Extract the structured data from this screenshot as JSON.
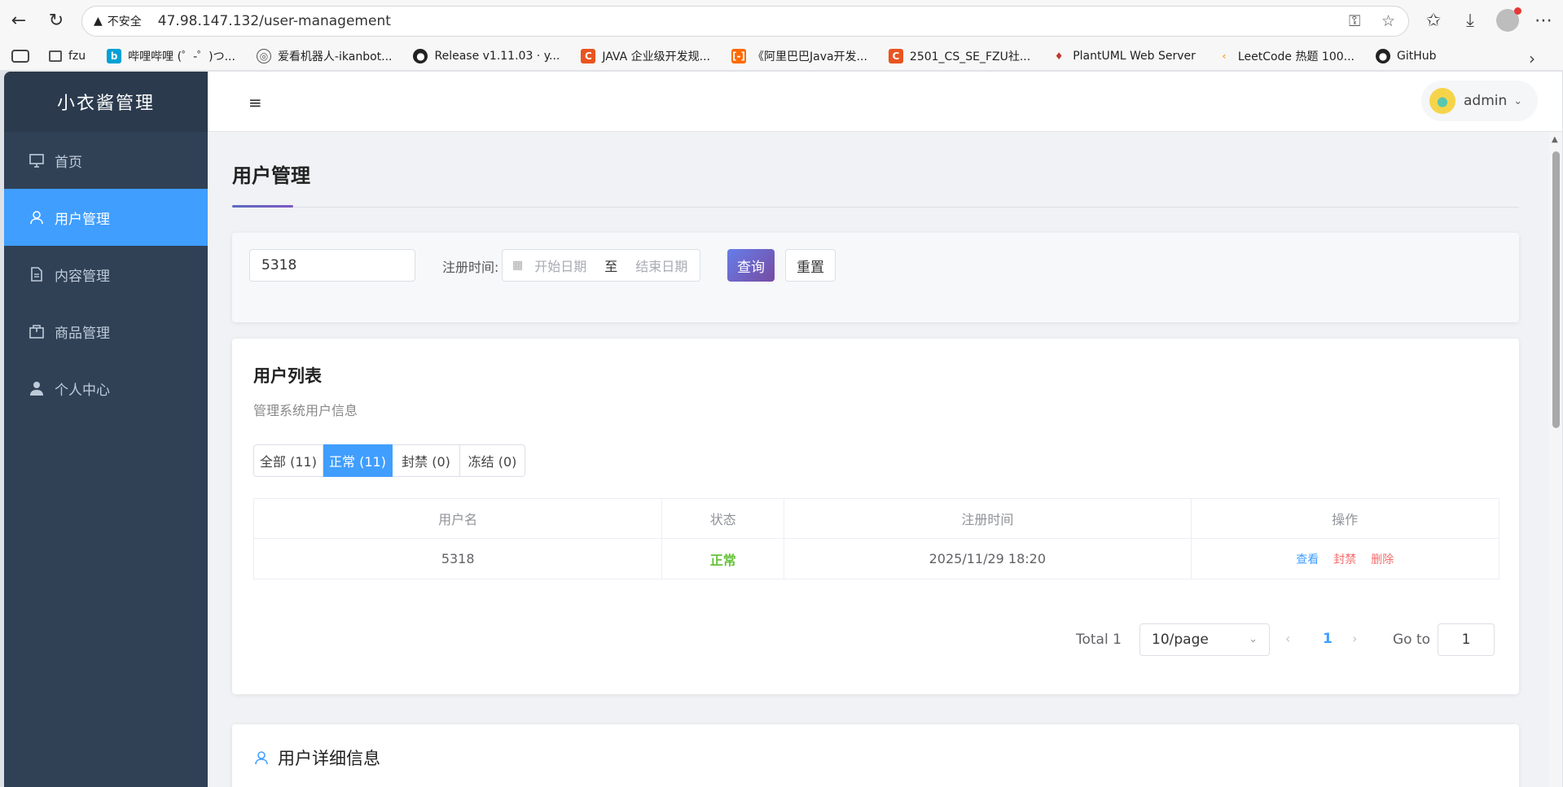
{
  "browser": {
    "insecure_label": "不安全",
    "url": "47.98.147.132/user-management",
    "bookmarks": [
      {
        "label": "fzu",
        "color": "#555555"
      },
      {
        "label": "哔哩哔哩 (゜-゜)つ...",
        "color": "#00a1d6"
      },
      {
        "label": "爱看机器人-ikanbot...",
        "color": "#555555"
      },
      {
        "label": "Release v1.11.03 · y...",
        "color": "#222222"
      },
      {
        "label": "JAVA 企业级开发规...",
        "color": "#e95420"
      },
      {
        "label": "《阿里巴巴Java开发...",
        "color": "#ff6a00"
      },
      {
        "label": "2501_CS_SE_FZU社...",
        "color": "#e95420"
      },
      {
        "label": "PlantUML Web Server",
        "color": "#c0392b"
      },
      {
        "label": "LeetCode 热题 100...",
        "color": "#ffa116"
      },
      {
        "label": "GitHub",
        "color": "#222222"
      }
    ]
  },
  "app": {
    "logo": "小衣酱管理",
    "menu": [
      {
        "label": "首页",
        "icon": "monitor-icon"
      },
      {
        "label": "用户管理",
        "icon": "user-icon"
      },
      {
        "label": "内容管理",
        "icon": "document-icon"
      },
      {
        "label": "商品管理",
        "icon": "box-icon"
      },
      {
        "label": "个人中心",
        "icon": "person-icon"
      }
    ],
    "active_menu_index": 1,
    "user": "admin"
  },
  "page": {
    "title": "用户管理",
    "search": {
      "keyword_value": "5318",
      "register_time_label": "注册时间:",
      "start_placeholder": "开始日期",
      "range_separator": "至",
      "end_placeholder": "结束日期",
      "query_label": "查询",
      "reset_label": "重置"
    },
    "list": {
      "title": "用户列表",
      "subtitle": "管理系统用户信息",
      "tabs": [
        {
          "label": "全部 (11)",
          "active": false
        },
        {
          "label": "正常 (11)",
          "active": true
        },
        {
          "label": "封禁 (0)",
          "active": false
        },
        {
          "label": "冻结 (0)",
          "active": false
        }
      ],
      "columns": [
        "用户名",
        "状态",
        "注册时间",
        "操作"
      ],
      "rows": [
        {
          "username": "5318",
          "status": "正常",
          "registered": "2025/11/29 18:20",
          "actions": [
            "查看",
            "封禁",
            "删除"
          ]
        }
      ],
      "pagination": {
        "total": "Total 1",
        "page_size": "10/page",
        "current_page": "1",
        "goto_label": "Go to",
        "goto_value": "1"
      }
    },
    "detail": {
      "title": "用户详细信息"
    }
  },
  "colors": {
    "sidebar_bg": "#304156",
    "active_menu": "#409eff",
    "primary_button_gradient": [
      "#667eea",
      "#764ba2"
    ],
    "status_normal": "#67c23a",
    "danger": "#f56c6c"
  }
}
